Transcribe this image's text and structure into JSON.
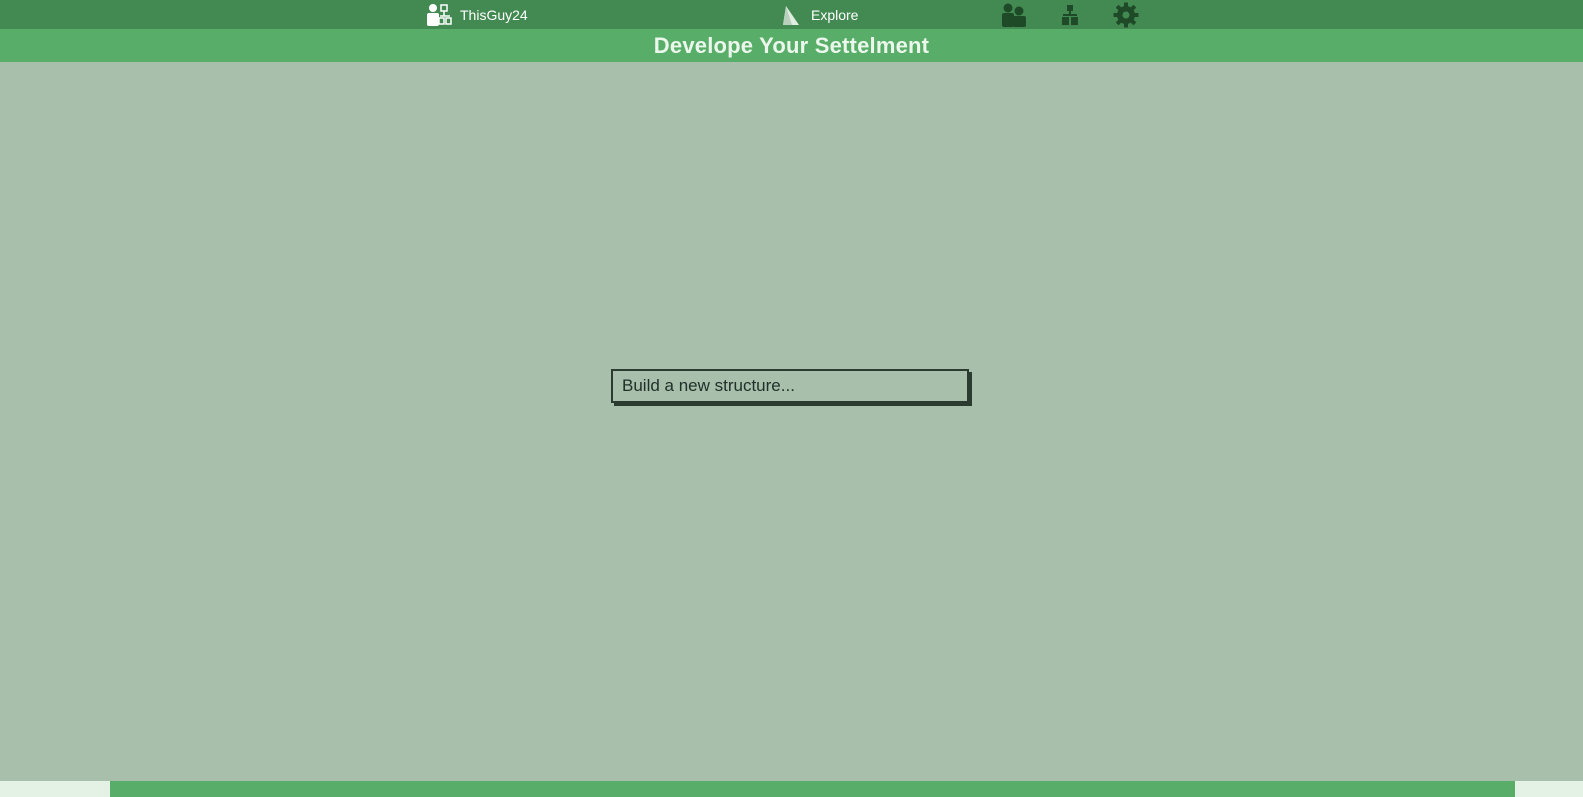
{
  "topbar": {
    "user": {
      "label": "ThisGuy24",
      "icon": "user-profile-icon"
    },
    "explore": {
      "label": "Explore",
      "icon": "explore-icon"
    },
    "icons": [
      {
        "name": "players-icon"
      },
      {
        "name": "hierarchy-icon"
      },
      {
        "name": "settings-gear-icon"
      }
    ]
  },
  "page": {
    "title": "Develope Your Settelment"
  },
  "main": {
    "build_button_label": "Build a new structure..."
  },
  "colors": {
    "topbar": "#438a52",
    "titlebar": "#58ad68",
    "background": "#a7bfab",
    "icon_dark": "#1f4a27",
    "footer_light": "#e4f2e6"
  }
}
